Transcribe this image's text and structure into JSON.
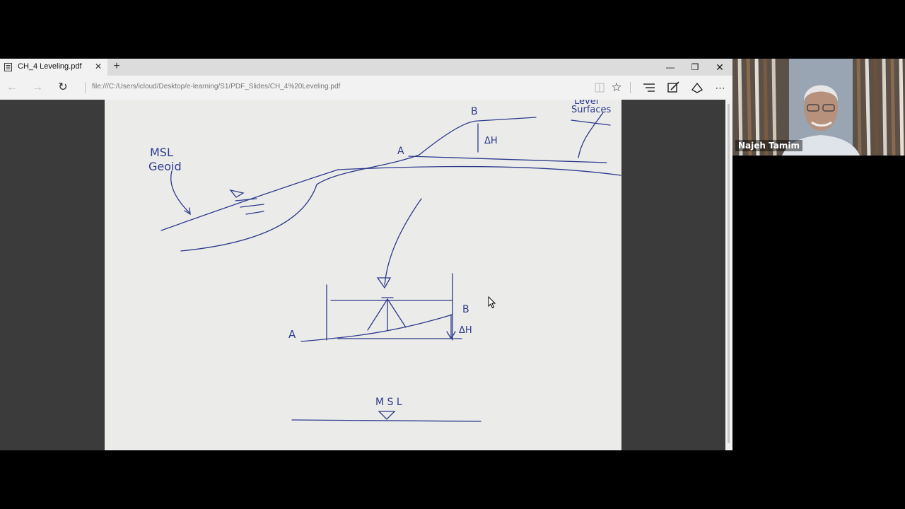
{
  "browser": {
    "tab": {
      "title": "CH_4 Leveling.pdf"
    },
    "url": "file:///C:/Users/icloud/Desktop/e-learning/S1/PDF_Slides/CH_4%20Leveling.pdf"
  },
  "sketch": {
    "labels": {
      "b_top": "B",
      "a_top": "A",
      "delta_h_top": "ΔH",
      "msl": "MSL",
      "geoid": "Geoid",
      "level_surfaces_1": "Level",
      "level_surfaces_2": "Surfaces",
      "a_bottom": "A",
      "b_bottom": "B",
      "delta_h_bottom": "ΔH",
      "msl_bottom": "M S L"
    },
    "ink_color": "#2d3a8c"
  },
  "participant": {
    "name": "Najeh Tamim"
  }
}
